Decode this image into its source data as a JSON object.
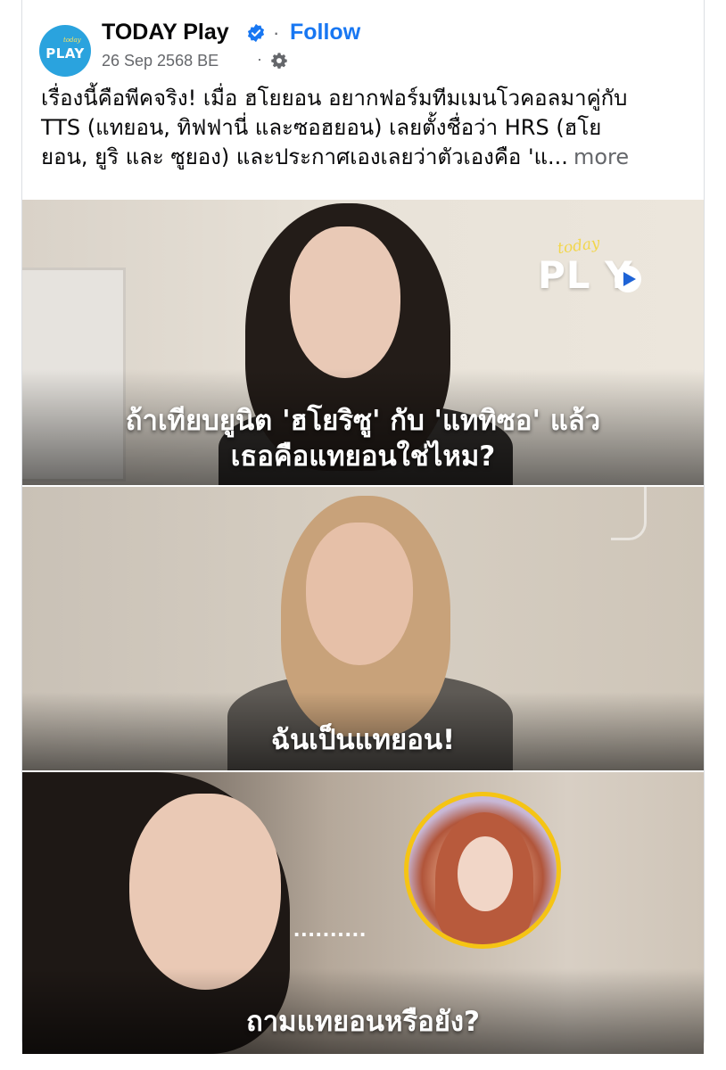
{
  "post": {
    "page_name": "TODAY Play",
    "follow_label": "Follow",
    "separator": "·",
    "date": "26 Sep 2568 BE",
    "meta_separator": "·",
    "avatar": {
      "small_text": "today",
      "text": "PLAY"
    },
    "icons": {
      "verified": "verified-badge-icon",
      "privacy": "gear-icon"
    },
    "caption_lines": [
      "เรื่องนี้คือพีคจริง! เมื่อ ฮโยยอน อยากฟอร์มทีมเมนโวคอลมาคู่กับ",
      "TTS (แทยอน, ทิฟฟานี่ และซอฮยอน) เลยตั้งชื่อว่า HRS (ฮโย",
      "ยอน, ยูริ และ ซูยอง) และประกาศเองเลยว่าตัวเองคือ 'แ..."
    ],
    "more_label": "more"
  },
  "media": {
    "watermark": {
      "small": "today",
      "main": "PL  Y"
    },
    "panel1_sub_line1": "ถ้าเทียบยูนิต 'ฮโยริซู' กับ 'แททิซอ' แล้ว",
    "panel1_sub_line2": "เธอคือแทยอนใช่ไหม?",
    "panel2_sub": "ฉันเป็นแทยอน!",
    "panel3_dots": "..........",
    "panel3_sub": "ถามแทยอนหรือยัง?"
  },
  "colors": {
    "link_blue": "#1877f2",
    "secondary_text": "#65676b",
    "avatar_bg": "#2aa3de",
    "inset_border": "#f5c414"
  }
}
